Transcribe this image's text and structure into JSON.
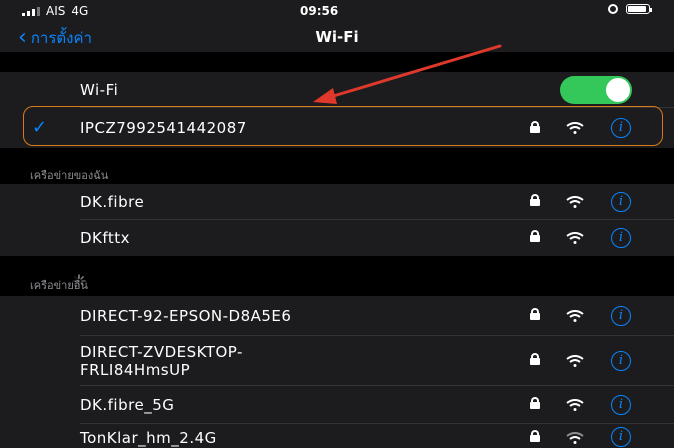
{
  "status": {
    "carrier": "AIS",
    "network": "4G",
    "time": "09:56"
  },
  "nav": {
    "back_label": "การตั้งค่า",
    "title": "Wi-Fi"
  },
  "wifi_toggle": {
    "label": "Wi-Fi",
    "on": true
  },
  "connected": {
    "ssid": "IPCZ7992541442087",
    "secured": true
  },
  "my_networks": {
    "header": "เครือข่ายของฉัน",
    "items": [
      {
        "ssid": "DK.fibre",
        "secured": true
      },
      {
        "ssid": "DKfttx",
        "secured": true
      }
    ]
  },
  "other_networks": {
    "header": "เครือข่ายอื่น",
    "items": [
      {
        "ssid": "DIRECT-92-EPSON-D8A5E6",
        "secured": true
      },
      {
        "ssid": "DIRECT-ZVDESKTOP-FRLI84HmsUP",
        "line1": "DIRECT-ZVDESKTOP-",
        "line2": "FRLI84HmsUP",
        "secured": true
      },
      {
        "ssid": "DK.fibre_5G",
        "secured": true
      },
      {
        "ssid": "TonKlar_hm_2.4G",
        "secured": true
      }
    ]
  },
  "icons": {
    "lock": "lock-icon",
    "wifi": "wifi-signal-icon",
    "info": "info-icon",
    "check": "checkmark-icon"
  },
  "colors": {
    "accent": "#0a84ff",
    "toggle_on": "#34c759",
    "highlight": "#d97a1a",
    "annotation_arrow": "#e0392b"
  }
}
